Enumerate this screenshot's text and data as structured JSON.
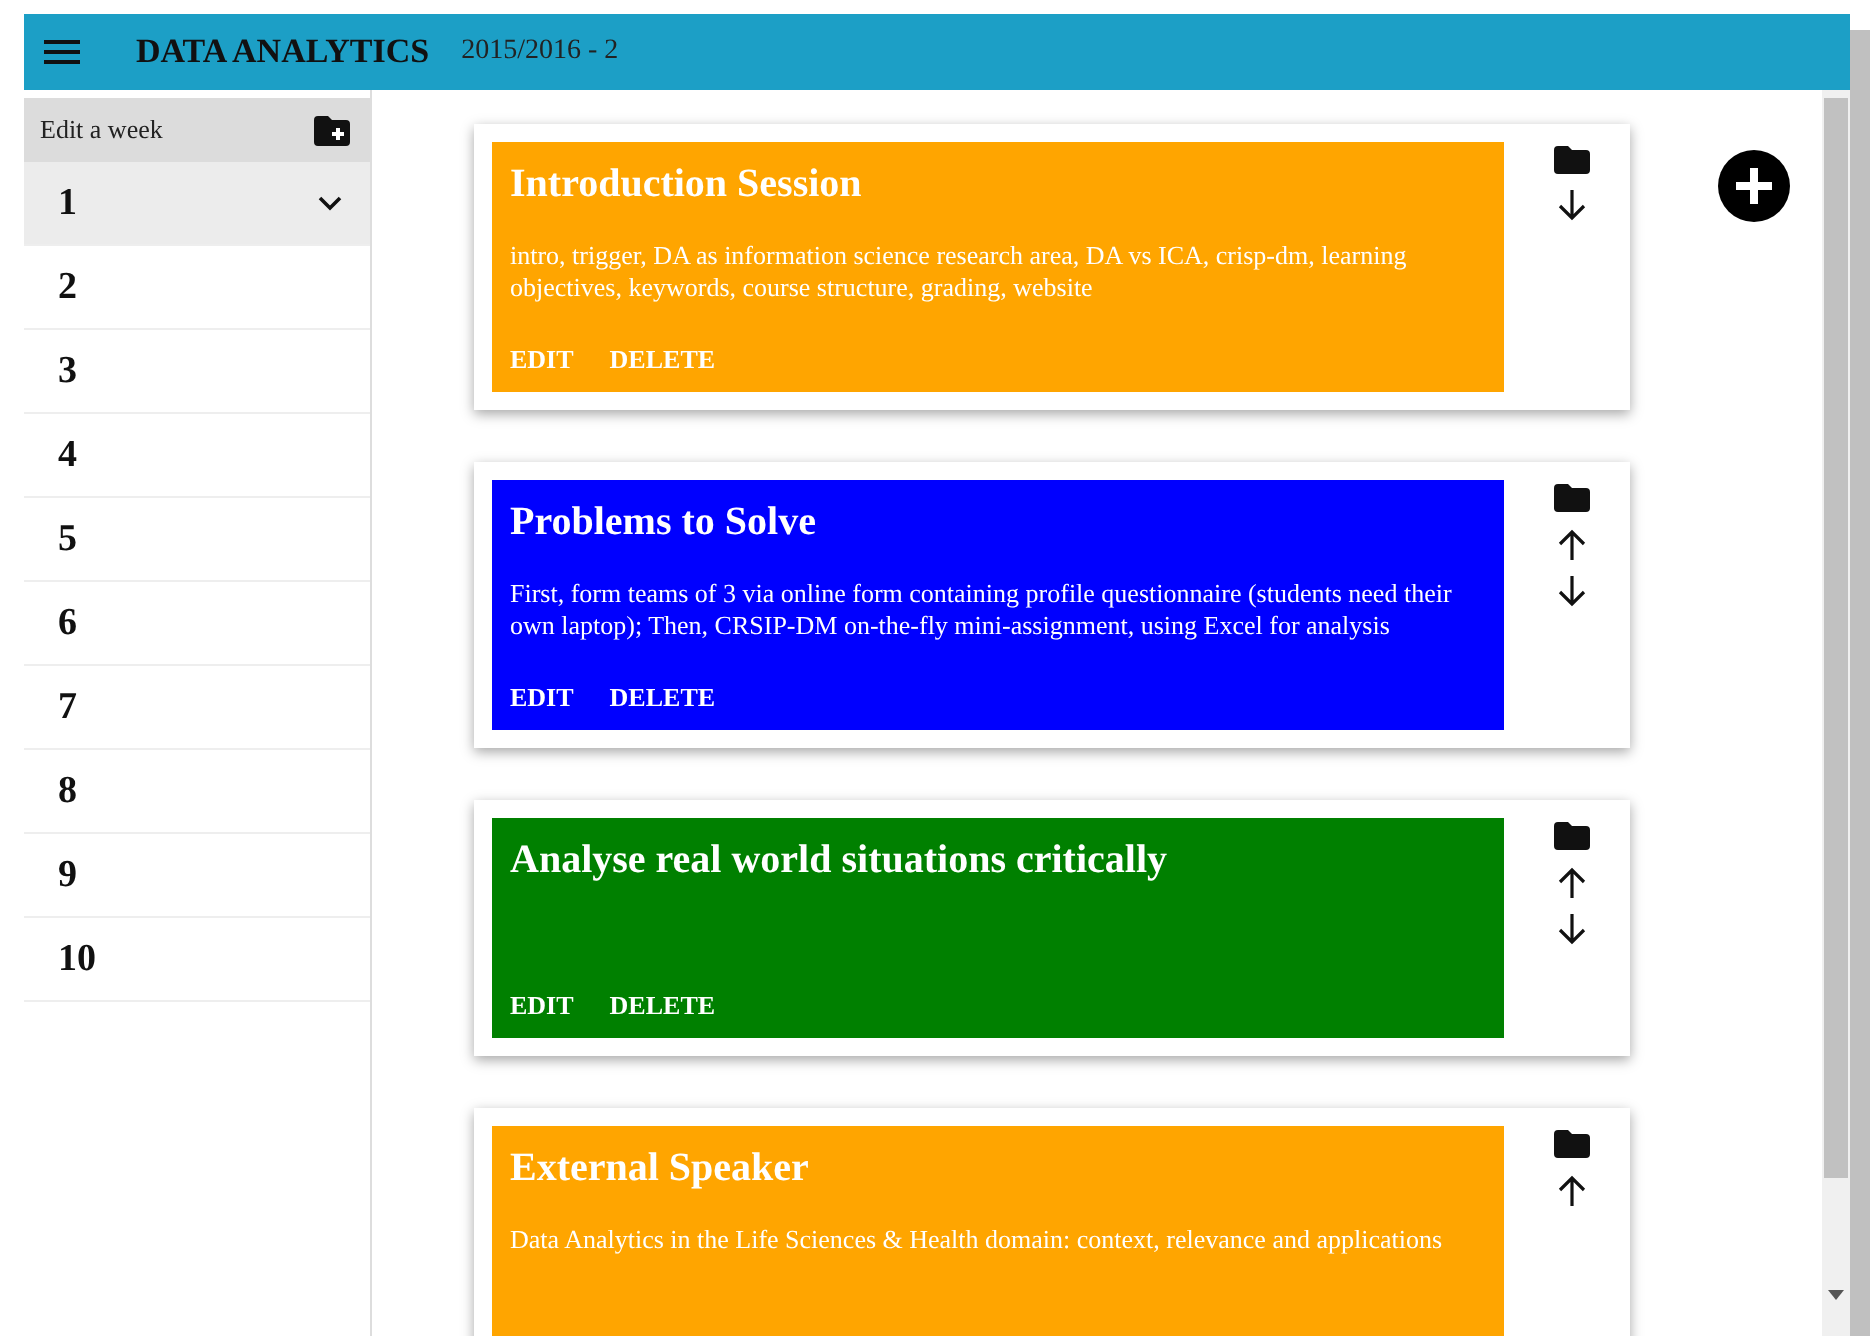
{
  "header": {
    "title": "DATA ANALYTICS",
    "term": "2015/2016 - 2"
  },
  "sidebar": {
    "heading": "Edit a week",
    "weeks": [
      {
        "label": "1",
        "selected": true,
        "expanded": true
      },
      {
        "label": "2",
        "selected": false,
        "expanded": false
      },
      {
        "label": "3",
        "selected": false,
        "expanded": false
      },
      {
        "label": "4",
        "selected": false,
        "expanded": false
      },
      {
        "label": "5",
        "selected": false,
        "expanded": false
      },
      {
        "label": "6",
        "selected": false,
        "expanded": false
      },
      {
        "label": "7",
        "selected": false,
        "expanded": false
      },
      {
        "label": "8",
        "selected": false,
        "expanded": false
      },
      {
        "label": "9",
        "selected": false,
        "expanded": false
      },
      {
        "label": "10",
        "selected": false,
        "expanded": false
      }
    ]
  },
  "sessions": [
    {
      "title": "Introduction Session",
      "description": "intro, trigger, DA as information science research area, DA vs ICA, crisp-dm, learning objectives, keywords, course structure, grading, website",
      "color": "#ffa500",
      "actions": [
        "EDIT",
        "DELETE"
      ],
      "can_move_up": false,
      "can_move_down": true
    },
    {
      "title": "Problems to Solve",
      "description": "First, form teams of 3 via online form containing profile questionnaire (students need their own laptop); Then, CRSIP-DM on-the-fly mini-assignment, using Excel for analysis",
      "color": "#0000ff",
      "actions": [
        "EDIT",
        "DELETE"
      ],
      "can_move_up": true,
      "can_move_down": true
    },
    {
      "title": "Analyse real world situations critically",
      "color": "#008000",
      "actions": [
        "EDIT",
        "DELETE"
      ],
      "can_move_up": true,
      "can_move_down": true
    },
    {
      "title": "External Speaker",
      "description": "Data Analytics in the Life Sciences & Health domain: context, relevance and applications",
      "color": "#ffa500",
      "can_move_up": true,
      "can_move_down": false
    }
  ]
}
